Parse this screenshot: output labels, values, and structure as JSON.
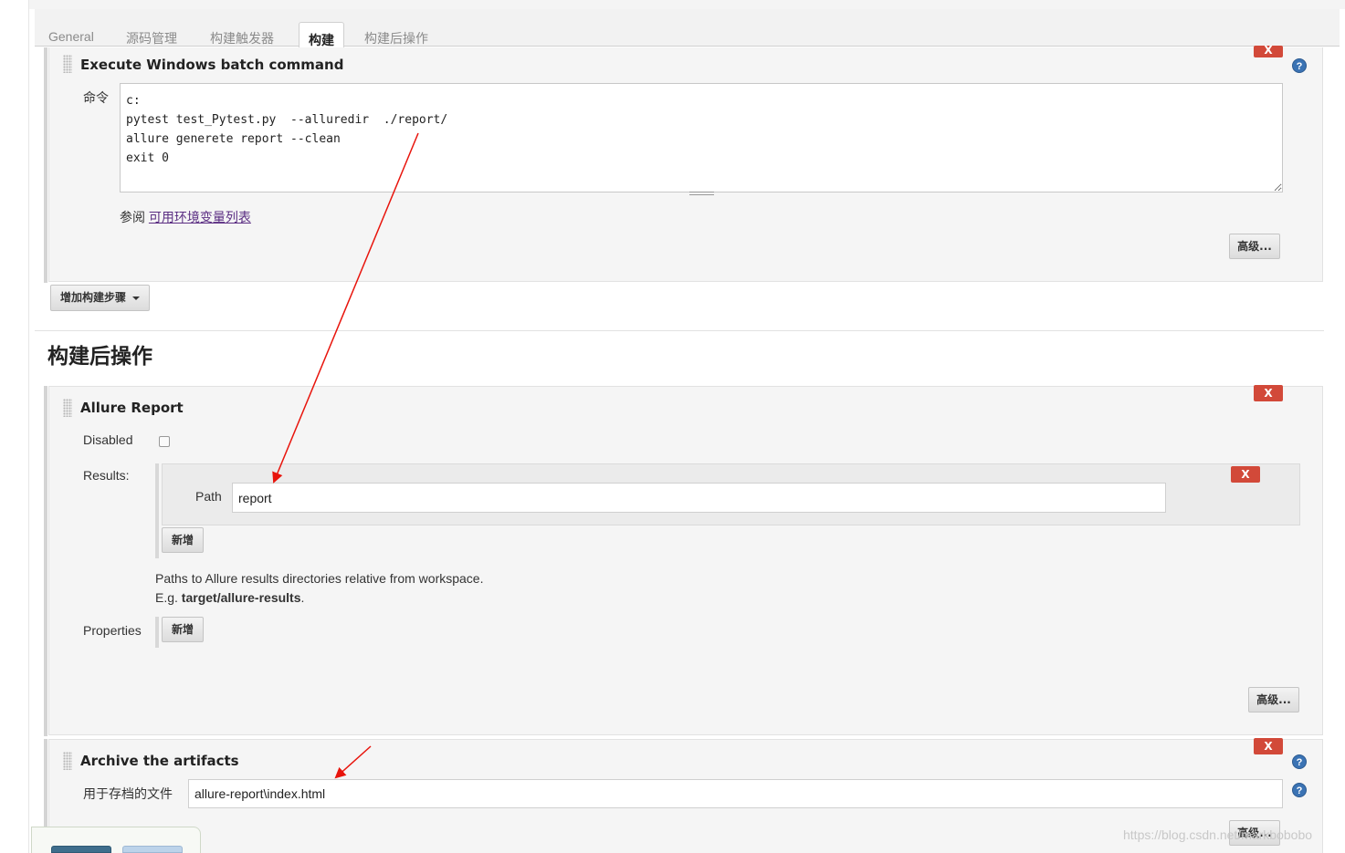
{
  "tabs": [
    {
      "label": "General"
    },
    {
      "label": "源码管理"
    },
    {
      "label": "构建触发器"
    },
    {
      "label": "构建"
    },
    {
      "label": "构建后操作"
    }
  ],
  "active_tab": "构建",
  "build_step": {
    "title": "Execute Windows batch command",
    "command_label": "命令",
    "command_value": "c:\npytest test_Pytest.py  --alluredir  ./report/\nallure generete report --clean\nexit 0",
    "see_prefix": "参阅",
    "env_link": "可用环境变量列表",
    "advanced_button": "高级...",
    "delete_button": "X",
    "help_icon": "question-circle"
  },
  "add_build_step_button": "增加构建步骤",
  "post_build": {
    "heading": "构建后操作",
    "allure": {
      "title": "Allure Report",
      "delete_button": "X",
      "disabled_label": "Disabled",
      "disabled_checked": false,
      "results_label": "Results:",
      "path_label": "Path",
      "path_value": "report",
      "path_delete_button": "X",
      "add_button": "新增",
      "help_line1": "Paths to Allure results directories relative from workspace.",
      "help_line2_prefix": "E.g. ",
      "help_line2_bold": "target/allure-results",
      "help_line2_suffix": ".",
      "properties_label": "Properties",
      "properties_add_button": "新增",
      "advanced_button": "高级..."
    },
    "archive": {
      "title": "Archive the artifacts",
      "delete_button": "X",
      "files_label": "用于存档的文件",
      "files_value": "allure-report\\index.html",
      "advanced_button": "高级..."
    }
  },
  "watermark": "https://blog.csdn.net/markbobobo",
  "colors": {
    "delete_red": "#d24939",
    "help_blue": "#3b73b4",
    "annotation_arrow": "#e8140c",
    "link_purple": "#5a2d82"
  }
}
